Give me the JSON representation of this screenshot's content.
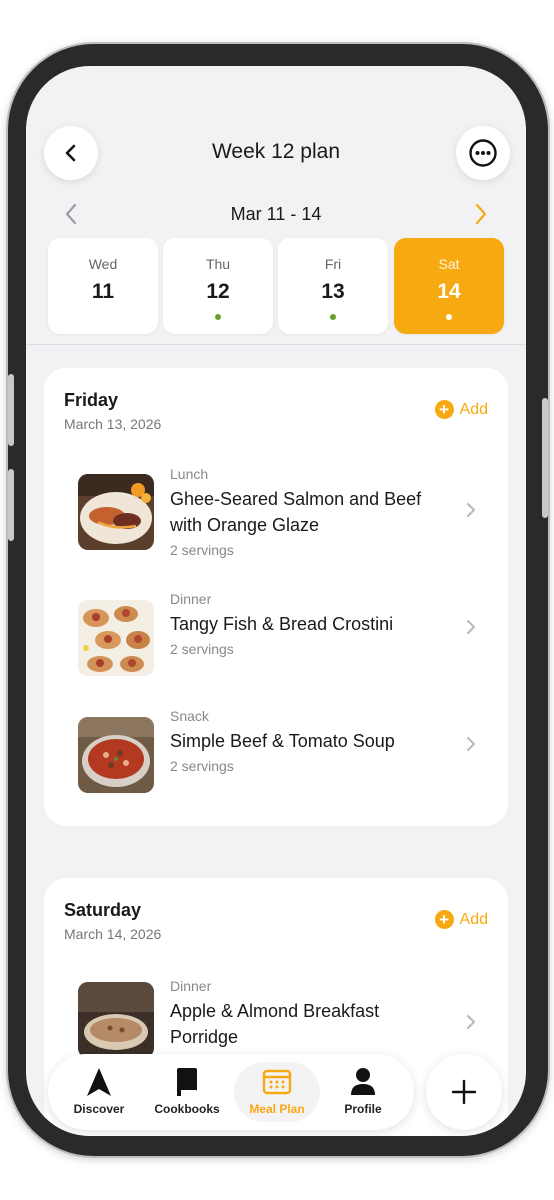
{
  "header": {
    "title": "Week 12 plan"
  },
  "range": {
    "label": "Mar 11 - 14"
  },
  "days": [
    {
      "name": "Wed",
      "num": "11"
    },
    {
      "name": "Thu",
      "num": "12"
    },
    {
      "name": "Fri",
      "num": "13"
    },
    {
      "name": "Sat",
      "num": "14"
    }
  ],
  "colors": {
    "accent": "#f7a911",
    "dot": "#6b9f2a",
    "background": "#f2f2f4"
  },
  "sections": [
    {
      "title": "Friday",
      "date": "March 13, 2026",
      "add_label": "Add",
      "meals": [
        {
          "type": "Lunch",
          "name": "Ghee-Seared Salmon and Beef with Orange Glaze",
          "servings": "2 servings"
        },
        {
          "type": "Dinner",
          "name": "Tangy Fish & Bread Crostini",
          "servings": "2 servings"
        },
        {
          "type": "Snack",
          "name": "Simple Beef & Tomato Soup",
          "servings": "2 servings"
        }
      ]
    },
    {
      "title": "Saturday",
      "date": "March 14, 2026",
      "add_label": "Add",
      "meals": [
        {
          "type": "Dinner",
          "name": "Apple & Almond Breakfast Porridge"
        }
      ]
    }
  ],
  "tabs": [
    {
      "label": "Discover",
      "icon": "navigation-arrow-icon"
    },
    {
      "label": "Cookbooks",
      "icon": "book-icon"
    },
    {
      "label": "Meal Plan",
      "icon": "calendar-icon"
    },
    {
      "label": "Profile",
      "icon": "person-icon"
    }
  ]
}
